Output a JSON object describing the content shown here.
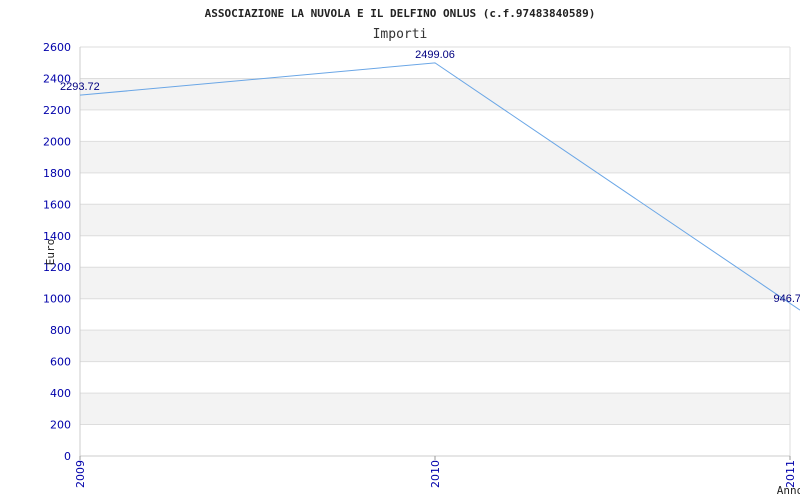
{
  "chart_data": {
    "type": "line",
    "title": "ASSOCIAZIONE LA NUVOLA E IL DELFINO ONLUS (c.f.97483840589)",
    "subtitle": "Importi",
    "xlabel": "Anno",
    "ylabel": "Euro",
    "categories": [
      "2009",
      "2010",
      "2011"
    ],
    "series": [
      {
        "values": [
          2293.72,
          2499.06,
          946.7
        ],
        "labels": [
          "2293.72",
          "2499.06",
          "946.7"
        ]
      }
    ],
    "yticks": [
      "0",
      "200",
      "400",
      "600",
      "800",
      "1000",
      "1200",
      "1400",
      "1600",
      "1800",
      "2000",
      "2200",
      "2400",
      "2600"
    ],
    "ylim": [
      0,
      2600
    ],
    "grid": true,
    "colors": {
      "line": "#6aa6e6",
      "tick_text": "#0000aa",
      "label_text": "#000080",
      "band": "#f3f3f3",
      "gridline": "#dddddd"
    }
  }
}
